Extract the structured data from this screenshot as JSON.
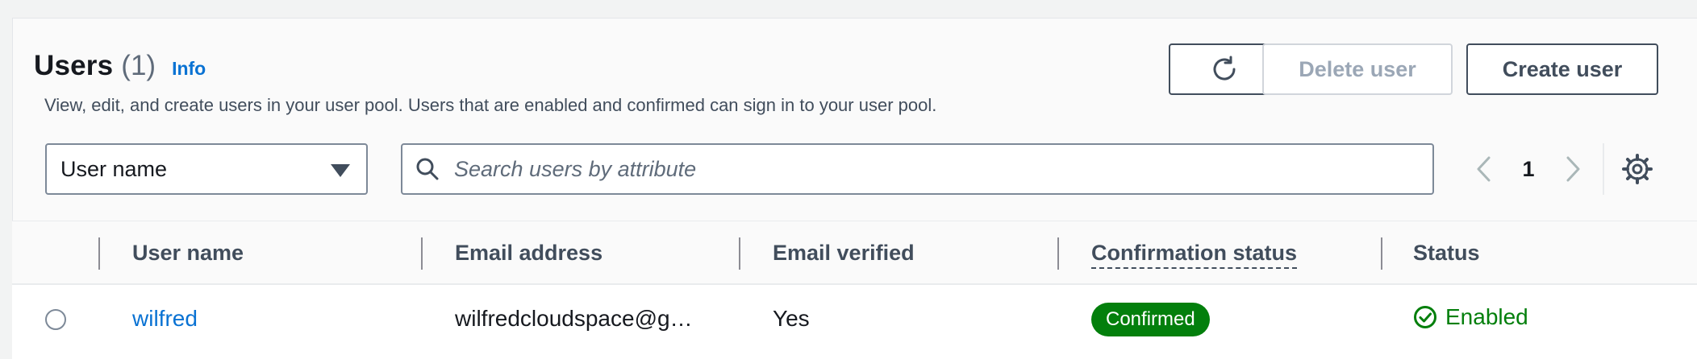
{
  "header": {
    "title": "Users",
    "count": "(1)",
    "info": "Info",
    "description": "View, edit, and create users in your user pool. Users that are enabled and confirmed can sign in to your user pool."
  },
  "actions": {
    "refresh_icon": "refresh-icon",
    "delete_label": "Delete user",
    "create_label": "Create user"
  },
  "filter": {
    "attribute_selected": "User name",
    "search_placeholder": "Search users by attribute"
  },
  "pagination": {
    "page": "1"
  },
  "table": {
    "columns": [
      "User name",
      "Email address",
      "Email verified",
      "Confirmation status",
      "Status"
    ],
    "rows": [
      {
        "user_name": "wilfred",
        "email": "wilfredcloudspace@g…",
        "email_verified": "Yes",
        "confirmation_status": "Confirmed",
        "status": "Enabled"
      }
    ]
  },
  "colors": {
    "accent": "#0972d3",
    "success": "#037f0c",
    "border": "#7d8998"
  }
}
